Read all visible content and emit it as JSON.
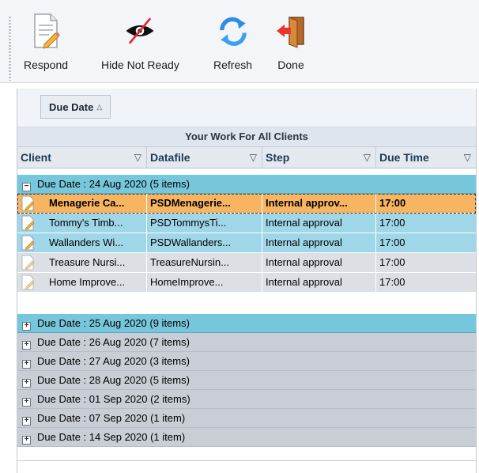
{
  "toolbar": {
    "buttons": [
      {
        "label": "Respond",
        "icon": "respond-icon"
      },
      {
        "label": "Hide Not Ready",
        "icon": "hide-not-ready-icon"
      },
      {
        "label": "Refresh",
        "icon": "refresh-icon"
      },
      {
        "label": "Done",
        "icon": "done-icon"
      }
    ]
  },
  "grid": {
    "group_by": "Due Date",
    "banner": "Your Work For All Clients",
    "columns": [
      "Client",
      "Datafile",
      "Step",
      "Due Time"
    ],
    "groups": [
      {
        "label": "Due Date : 24 Aug 2020 (5 items)",
        "expanded": true
      },
      {
        "label": "Due Date : 25 Aug 2020 (9 items)",
        "expanded": false
      },
      {
        "label": "Due Date : 26 Aug 2020 (7 items)",
        "expanded": false
      },
      {
        "label": "Due Date : 27 Aug 2020 (3 items)",
        "expanded": false
      },
      {
        "label": "Due Date : 28 Aug 2020 (5 items)",
        "expanded": false
      },
      {
        "label": "Due Date : 01 Sep 2020 (2 items)",
        "expanded": false
      },
      {
        "label": "Due Date : 07 Sep 2020 (1 item)",
        "expanded": false
      },
      {
        "label": "Due Date : 14 Sep 2020 (1 item)",
        "expanded": false
      }
    ],
    "rows": [
      {
        "client": "Menagerie Ca...",
        "datafile": "PSDMenagerie...",
        "step": "Internal approv...",
        "due_time": "17:00"
      },
      {
        "client": "Tommy's Timb...",
        "datafile": "PSDTommysTi...",
        "step": "Internal approval",
        "due_time": "17:00"
      },
      {
        "client": "Wallanders Wi...",
        "datafile": "PSDWallanders...",
        "step": "Internal approval",
        "due_time": "17:00"
      },
      {
        "client": "Treasure Nursi...",
        "datafile": "TreasureNursin...",
        "step": "Internal approval",
        "due_time": "17:00"
      },
      {
        "client": "Home Improve...",
        "datafile": "HomeImprove...",
        "step": "Internal approval",
        "due_time": "17:00"
      }
    ]
  },
  "colors": {
    "selected_row": "#f7b561",
    "highlight_row": "#9fd6e8",
    "group_highlight": "#77c7dc",
    "group_default": "#c9ced6"
  }
}
